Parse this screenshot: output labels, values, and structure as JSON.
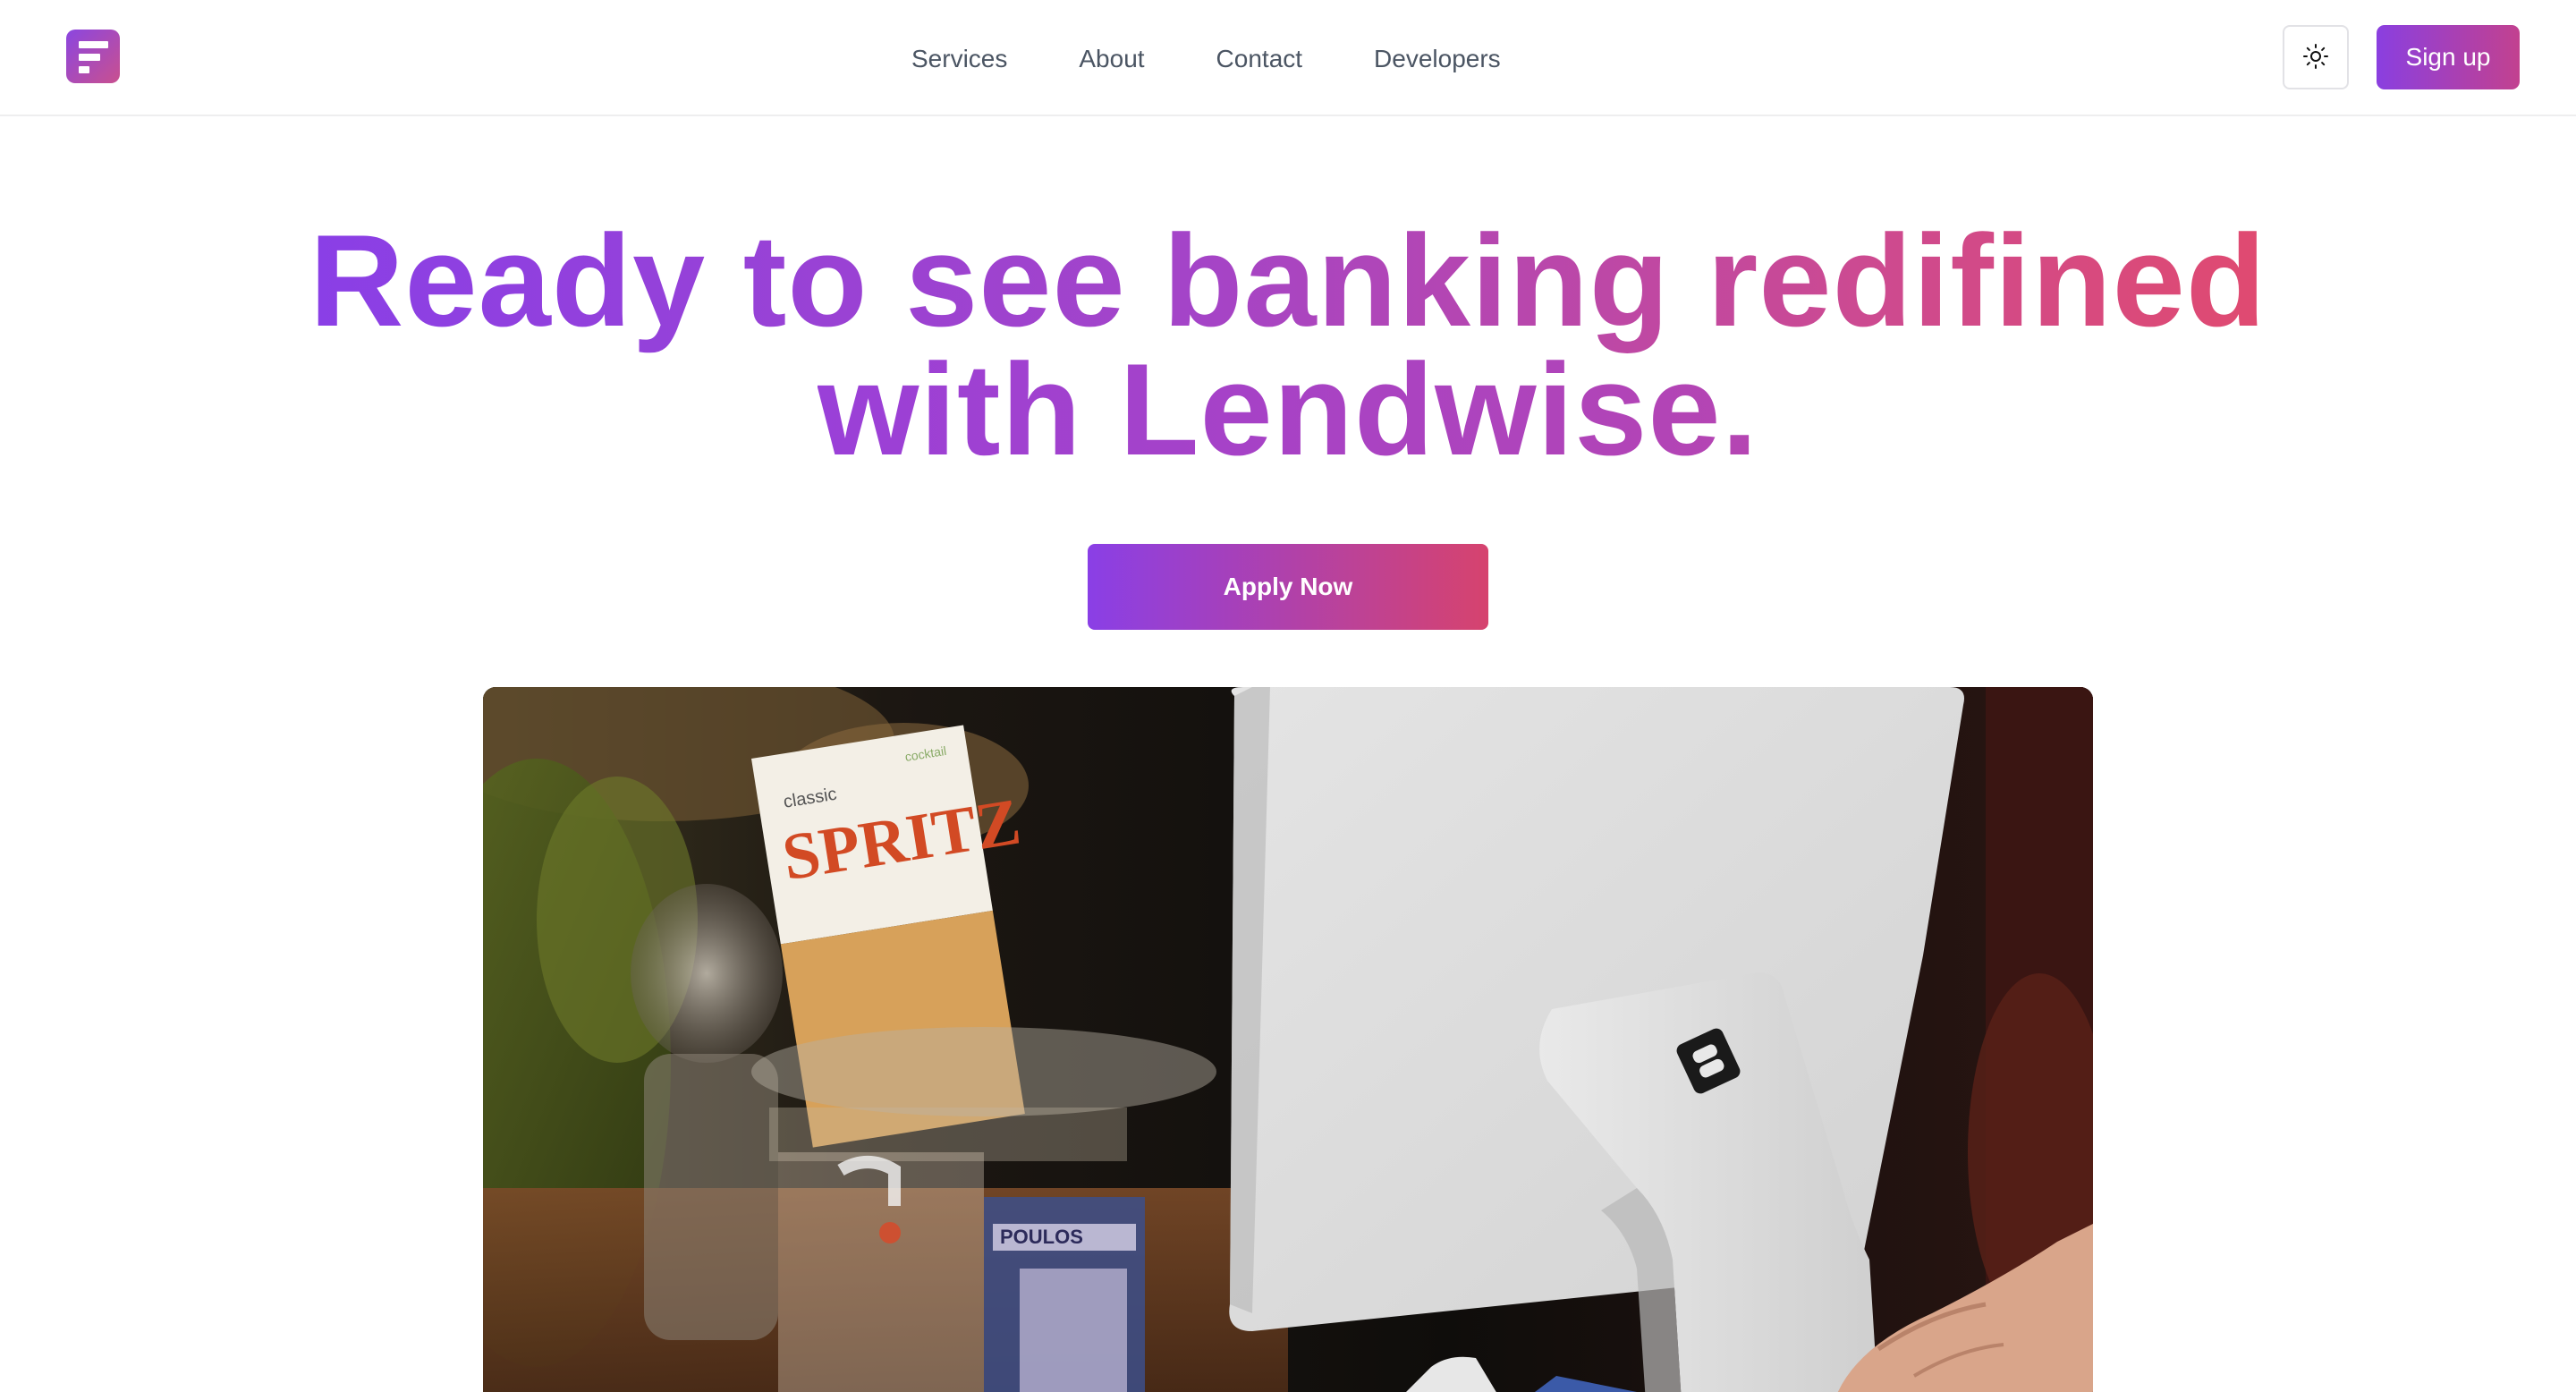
{
  "header": {
    "logo_icon": "lendwise-logo-icon",
    "nav": [
      "Services",
      "About",
      "Contact",
      "Developers"
    ],
    "theme_toggle_icon": "sun-icon",
    "signup_label": "Sign up"
  },
  "hero": {
    "title_line1": "Ready to see banking redifined",
    "title_line2": "with Lendwise.",
    "cta_label": "Apply Now"
  },
  "photo": {
    "sign_small": "classic",
    "sign_big": "SPRITZ",
    "sign_corner": "cocktail",
    "bag_text": "POULOS"
  },
  "colors": {
    "gradient_start": "#8a3fe6",
    "gradient_end": "#d6436e",
    "nav_text": "#4b5563"
  }
}
